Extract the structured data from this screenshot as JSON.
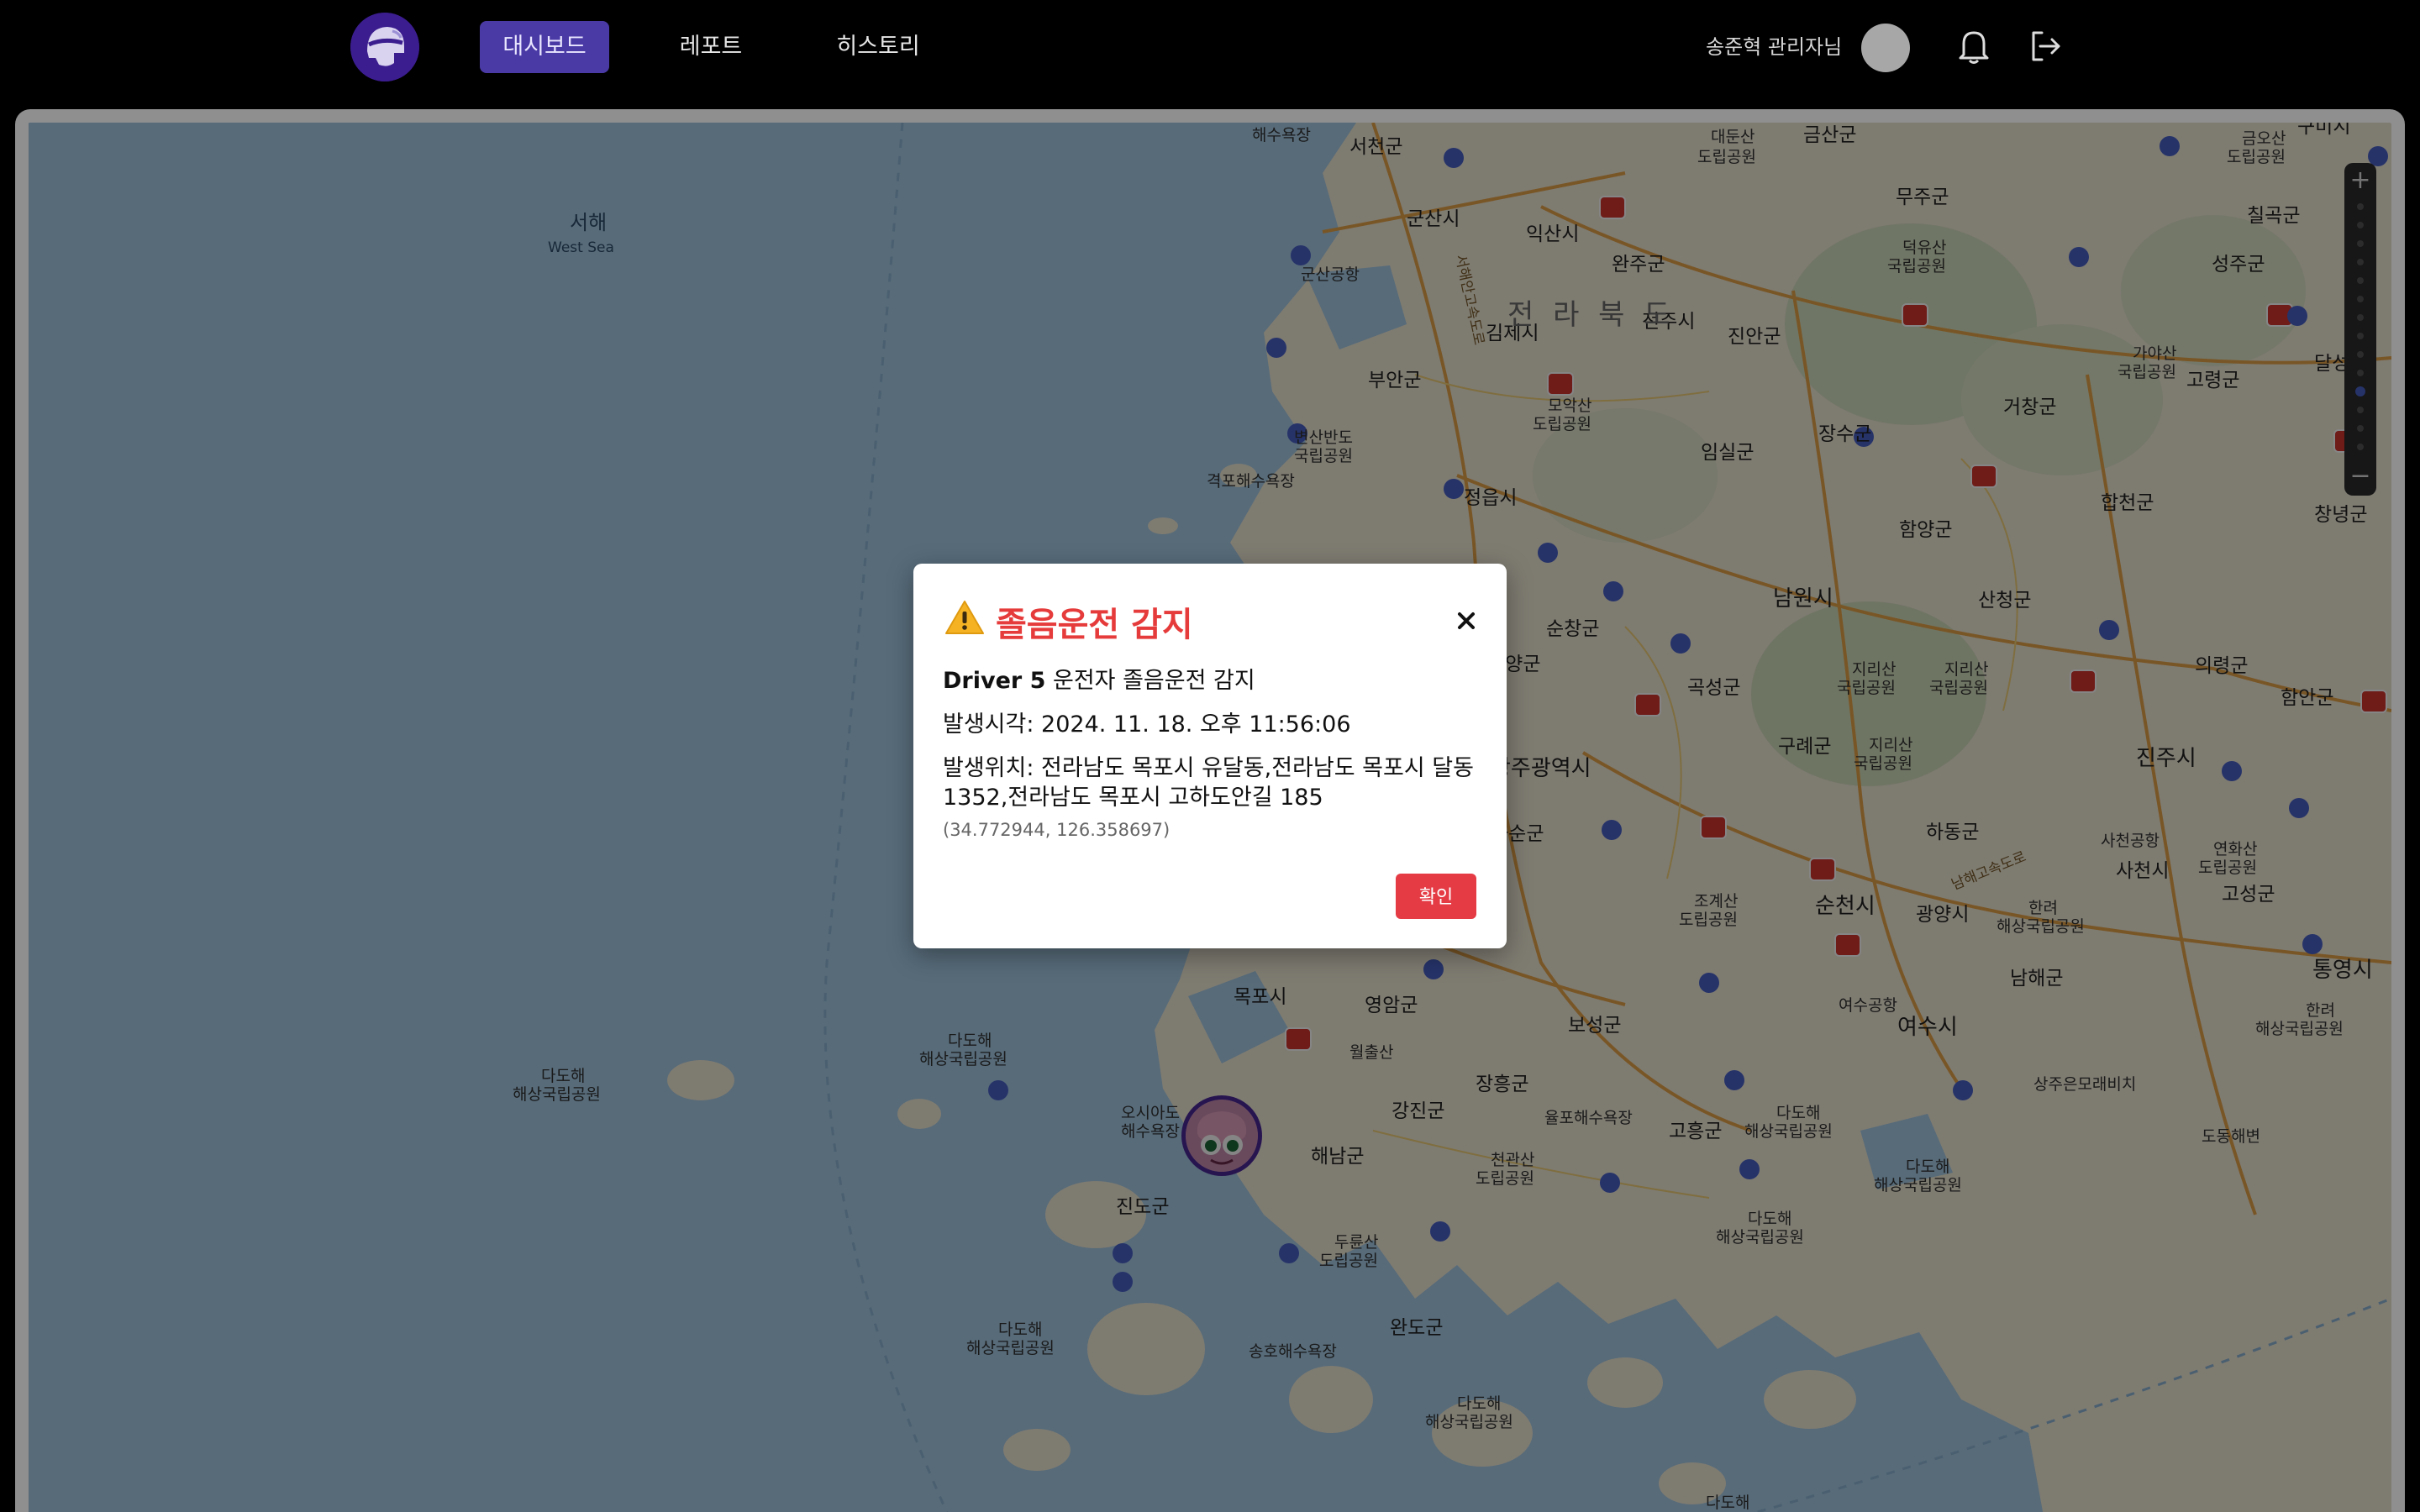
{
  "nav": {
    "logo_icon": "driver-helmet-logo-icon",
    "items": [
      {
        "label": "대시보드",
        "active": true
      },
      {
        "label": "레포트",
        "active": false
      },
      {
        "label": "히스토리",
        "active": false
      }
    ],
    "user_name": "송준혁 관리자님",
    "bell_icon": "bell-icon",
    "logout_icon": "logout-icon"
  },
  "map": {
    "labels": {
      "west_sea_ko": "서해",
      "west_sea_en": "West Sea",
      "haesu": "해수욕장",
      "seocheon": "서천군",
      "gunsan": "군산시",
      "gunsan_airport": "군산공항",
      "iksan": "익산시",
      "daedunsan": "대둔산",
      "daedunsan2": "도립공원",
      "geumsan": "금산군",
      "muju": "무주군",
      "deogyusan1": "덕유산",
      "deogyusan2": "국립공원",
      "wanju": "완주군",
      "jeonju": "전주시",
      "gimje": "김제시",
      "jeonbuk": "전 라 북 도",
      "jinan": "진안군",
      "buan": "부안군",
      "moak1": "모악산",
      "moak2": "도립공원",
      "jangsu": "장수군",
      "imsil": "임실군",
      "geochang": "거창군",
      "gayasan1": "가야산",
      "gayasan2": "국립공원",
      "goryeong": "고령군",
      "byeonsan1": "변산반도",
      "byeonsan2": "국립공원",
      "gyeokpo": "격포해수욕장",
      "jeongeup": "정읍시",
      "hamyang": "함양군",
      "hapcheon": "합천군",
      "namwon": "남원시",
      "sancheong": "산청군",
      "sunchang": "순창군",
      "jirisan1": "지리산",
      "jirisan2": "국립공원",
      "uiryeong": "의령군",
      "haman": "함안군",
      "gwangju": "광주광역시",
      "gokseong": "곡성군",
      "damyang": "담양군",
      "gurye": "구례군",
      "jinju": "진주시",
      "hwasun": "화순군",
      "hadong": "하동군",
      "sacheon_airport": "사천공항",
      "sacheon": "사천시",
      "yeonhwa1": "연화산",
      "yeonhwa2": "도립공원",
      "goseong": "고성군",
      "suncheon": "순천시",
      "gwangyang": "광양시",
      "jogye1": "조계산",
      "jogye2": "도립공원",
      "hallyeo1": "한려",
      "hallyeo2": "해상국립공원",
      "namhae": "남해군",
      "tongyeong": "통영시",
      "yeosu_airport": "여수공항",
      "yeosu": "여수시",
      "mokpo": "목포시",
      "yeongam": "영암군",
      "wolchul": "월출산",
      "boseong": "보성군",
      "jangheung": "장흥군",
      "gangjin": "강진군",
      "yulpo": "율포해수욕장",
      "goheung": "고흥군",
      "dadohae1": "다도해",
      "dadohae2": "해상국립공원",
      "osiado1": "오시아도",
      "osiado2": "해수욕장",
      "haenam": "해남군",
      "jindo": "진도군",
      "duryun1": "두륜산",
      "duryun2": "도립공원",
      "cheongwan1": "천관산",
      "cheongwan2": "도립공원",
      "wando": "완도군",
      "songho": "송호해수욕장",
      "sangju_beach": "상주은모래비치",
      "dodong": "도동해변",
      "chilgok": "칠곡군",
      "seongju": "성주군",
      "geumo1": "금오산",
      "geumo2": "도립공원",
      "dalseong": "달성군",
      "changnyeong": "창녕군",
      "gumi": "구미시",
      "highway_west": "서해안고속도로",
      "highway_south": "남해고속도로"
    }
  },
  "modal": {
    "warning_icon": "warning-icon",
    "title": "졸음운전 감지",
    "driver": "Driver 5",
    "driver_suffix": " 운전자 졸음운전 감지",
    "time_label": "발생시각: ",
    "time_value": "2024. 11. 18. 오후 11:56:06",
    "location_label": "발생위치: ",
    "location_line1": "전라남도 목포시 유달동,전라남도 목포시 달동",
    "location_line2": "1352,전라남도 목포시 고하도안길 185",
    "coords": "(34.772944, 126.358697)",
    "confirm_label": "확인",
    "close_icon": "close-icon"
  }
}
